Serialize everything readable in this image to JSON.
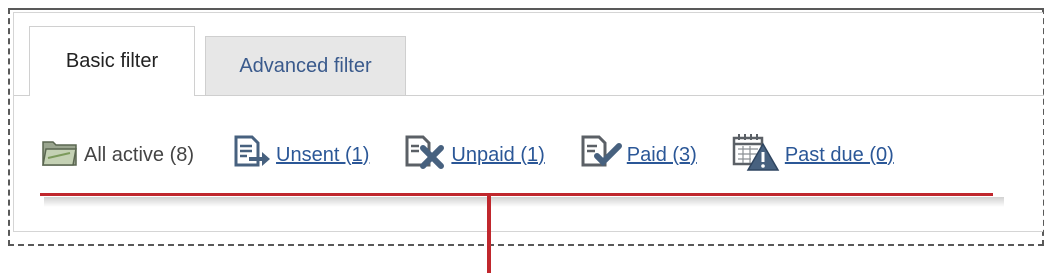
{
  "tabs": {
    "basic_label": "Basic filter",
    "advanced_label": "Advanced filter"
  },
  "filters": [
    {
      "label": "All active (8)",
      "icon": "folder-icon",
      "link": false
    },
    {
      "label": "Unsent (1)",
      "icon": "document-send-icon",
      "link": true
    },
    {
      "label": "Unpaid (1)",
      "icon": "document-x-icon",
      "link": true
    },
    {
      "label": "Paid (3)",
      "icon": "document-check-icon",
      "link": true
    },
    {
      "label": "Past due (0)",
      "icon": "calendar-warning-icon",
      "link": true
    }
  ],
  "colors": {
    "link": "#2b5797",
    "accent_line": "#c0272d"
  }
}
